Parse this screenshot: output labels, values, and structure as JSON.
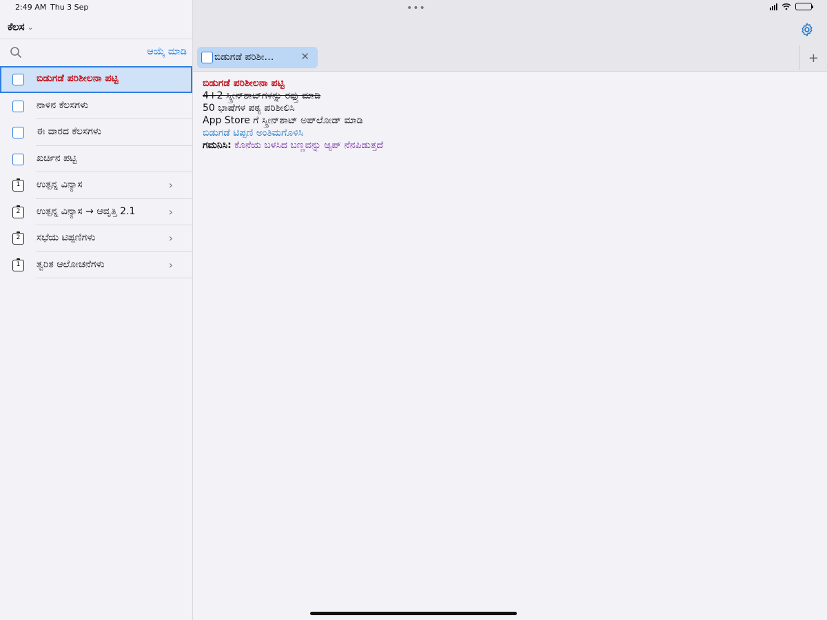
{
  "status_bar": {
    "time": "2:49 AM",
    "date": "Thu 3 Sep"
  },
  "sidebar": {
    "title": "ಕೆಲಸ",
    "select_label": "ಆಯ್ಕೆ ಮಾಡಿ",
    "items": [
      {
        "label": "ಬಿಡುಗಡೆ ಪರಿಶೀಲನಾ ಪಟ್ಟಿ",
        "kind": "checkbox",
        "selected": true
      },
      {
        "label": "ನಾಳಿನ ಕೆಲಸಗಳು",
        "kind": "checkbox"
      },
      {
        "label": "ಈ ವಾರದ ಕೆಲಸಗಳು",
        "kind": "checkbox"
      },
      {
        "label": "ಖರ್ಚಿನ ಪಟ್ಟಿ",
        "kind": "checkbox"
      },
      {
        "label": "ಉತ್ಪನ್ನ ವಿನ್ಯಾಸ",
        "kind": "group",
        "badge": "1"
      },
      {
        "label": "ಉತ್ಪನ್ನ ವಿನ್ಯಾಸ → ಆವೃತ್ತಿ 2.1",
        "kind": "group",
        "badge": "2"
      },
      {
        "label": "ಸಭೆಯ ಟಿಪ್ಪಣಿಗಳು",
        "kind": "group",
        "badge": "2"
      },
      {
        "label": "ತ್ವರಿತ ಆಲೋಚನೆಗಳು",
        "kind": "group",
        "badge": "1"
      }
    ]
  },
  "tabs": {
    "active_tab_label": "ಬಿಡುಗಡೆ ಪರಿಶೀ…",
    "close_symbol": "✕",
    "add_symbol": "+"
  },
  "document": {
    "title": "ಬಿಡುಗಡೆ ಪರಿಶೀಲನಾ ಪಟ್ಟಿ",
    "line1": "4+2 ಸ್ಕ್ರೀನ್‌ಶಾಟ್‌ಗಳನ್ನು ರಫ್ತು ಮಾಡಿ",
    "line2": "50 ಭಾಷೆಗಳ ಪಠ್ಯ ಪರಿಶೀಲಿಸಿ",
    "line3": "App Store ಗೆ ಸ್ಕ್ರೀನ್‌ಶಾಟ್ ಅಪ್‌ಲೋಡ್ ಮಾಡಿ",
    "line4": "ಬಿಡುಗಡೆ ಟಿಪ್ಪಣಿ ಅಂತಿಮಗೊಳಿಸಿ",
    "note_label": "ಗಮನಿಸಿ:",
    "note_text": " ಕೊನೆಯ ಬಳಸಿದ ಬಣ್ಣವನ್ನು ಆ್ಯಪ್ ನೆನಪಿಡುತ್ತದೆ"
  },
  "colors": {
    "accent": "#2f7de1",
    "title_red": "#c3141c",
    "link_blue": "#1f78c8",
    "note_purple": "#7c2fa8",
    "selection_bg": "#cfe2f7"
  },
  "icons": [
    "search-icon",
    "gear-icon",
    "chevron-right-icon",
    "chevron-down-icon",
    "close-icon",
    "plus-icon",
    "wifi-icon",
    "battery-icon"
  ]
}
